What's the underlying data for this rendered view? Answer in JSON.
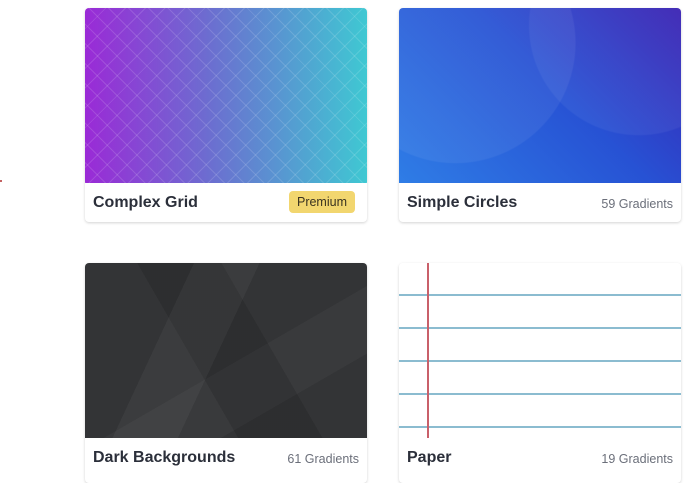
{
  "cards": [
    {
      "title": "Complex Grid",
      "badge": "Premium"
    },
    {
      "title": "Simple Circles",
      "count": "59 Gradients"
    },
    {
      "title": "Dark Backgrounds",
      "count": "61 Gradients"
    },
    {
      "title": "Paper",
      "count": "19 Gradients"
    }
  ]
}
